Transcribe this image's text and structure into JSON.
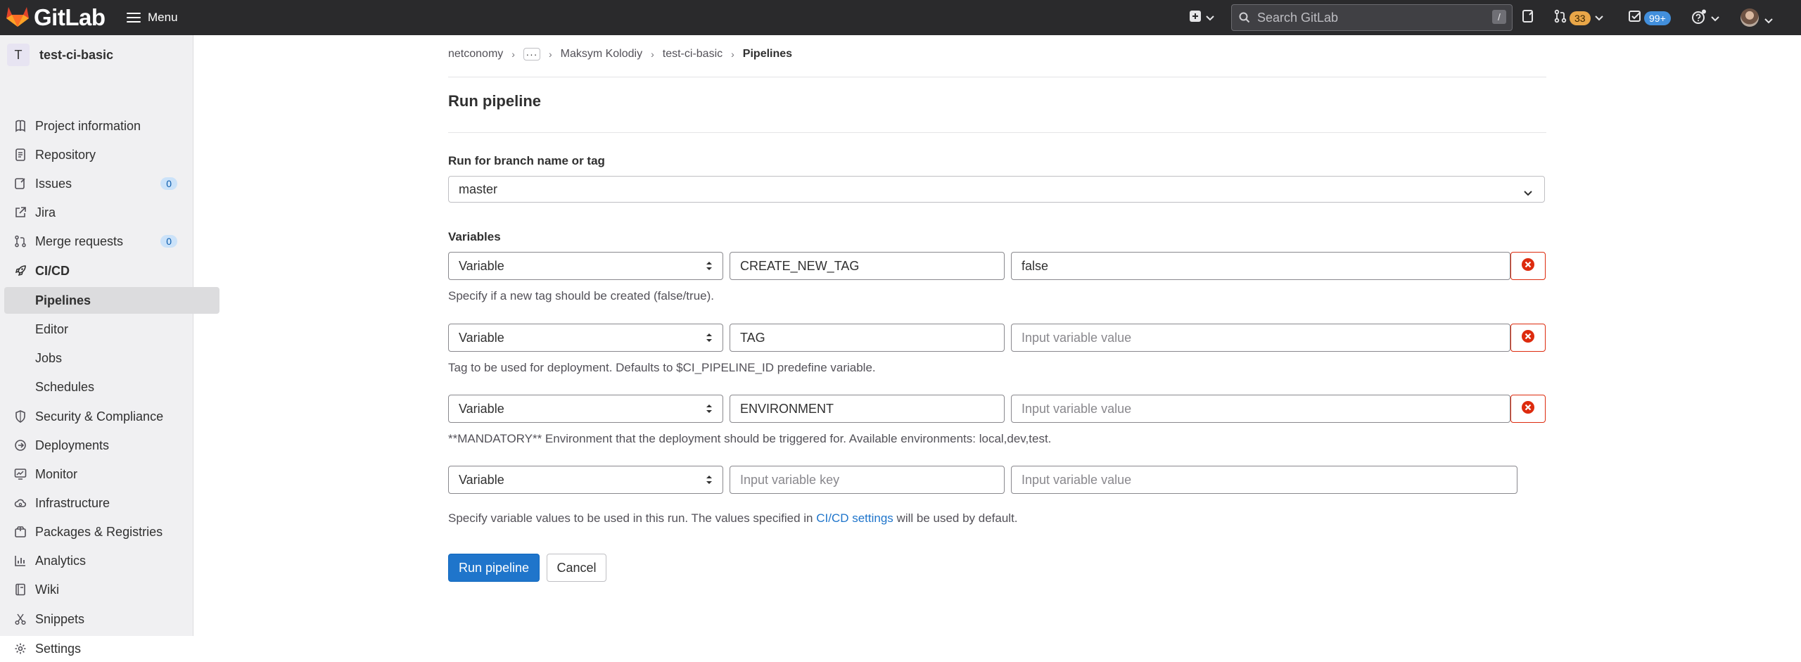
{
  "topbar": {
    "brand": "GitLab",
    "menu_label": "Menu",
    "search_placeholder": "Search GitLab",
    "search_shortcut": "/",
    "merge_requests_count": "33",
    "todos_count": "99+"
  },
  "sidebar": {
    "project_initial": "T",
    "project_name": "test-ci-basic",
    "items": [
      {
        "label": "Project information",
        "icon": "info-icon"
      },
      {
        "label": "Repository",
        "icon": "doc-icon"
      },
      {
        "label": "Issues",
        "icon": "issues-icon",
        "count": "0"
      },
      {
        "label": "Jira",
        "icon": "external-link-icon"
      },
      {
        "label": "Merge requests",
        "icon": "merge-request-icon",
        "count": "0"
      },
      {
        "label": "CI/CD",
        "icon": "rocket-icon"
      },
      {
        "label": "Pipelines"
      },
      {
        "label": "Editor"
      },
      {
        "label": "Jobs"
      },
      {
        "label": "Schedules"
      },
      {
        "label": "Security & Compliance",
        "icon": "shield-icon"
      },
      {
        "label": "Deployments",
        "icon": "deployments-icon"
      },
      {
        "label": "Monitor",
        "icon": "monitor-icon"
      },
      {
        "label": "Infrastructure",
        "icon": "cloud-icon"
      },
      {
        "label": "Packages & Registries",
        "icon": "package-icon"
      },
      {
        "label": "Analytics",
        "icon": "chart-icon"
      },
      {
        "label": "Wiki",
        "icon": "book-icon"
      },
      {
        "label": "Snippets",
        "icon": "scissors-icon"
      },
      {
        "label": "Settings",
        "icon": "gear-icon"
      }
    ]
  },
  "breadcrumb": {
    "items": [
      "netconomy",
      "Maksym Kolodiy",
      "test-ci-basic",
      "Pipelines"
    ]
  },
  "main": {
    "title": "Run pipeline",
    "branch_label": "Run for branch name or tag",
    "branch_value": "master",
    "variables_label": "Variables",
    "variables": [
      {
        "type": "Variable",
        "key": "CREATE_NEW_TAG",
        "value": "false",
        "help": "Specify if a new tag should be created (false/true)."
      },
      {
        "type": "Variable",
        "key": "TAG",
        "value": "",
        "help": "Tag to be used for deployment. Defaults to $CI_PIPELINE_ID predefine variable."
      },
      {
        "type": "Variable",
        "key": "ENVIRONMENT",
        "value": "",
        "help": "**MANDATORY** Environment that the deployment should be triggered for. Available environments: local,dev,test."
      },
      {
        "type": "Variable",
        "key": "",
        "value": ""
      }
    ],
    "key_placeholder": "Input variable key",
    "value_placeholder": "Input variable value",
    "footer_help_before": "Specify variable values to be used in this run. The values specified in ",
    "footer_help_link": "CI/CD settings",
    "footer_help_after": " will be used by default.",
    "run_button": "Run pipeline",
    "cancel_button": "Cancel"
  },
  "colors": {
    "accent": "#1f75cb",
    "danger": "#dd2b0e",
    "topbar": "#2a2a2c",
    "sidebar": "#f0f0f2"
  }
}
